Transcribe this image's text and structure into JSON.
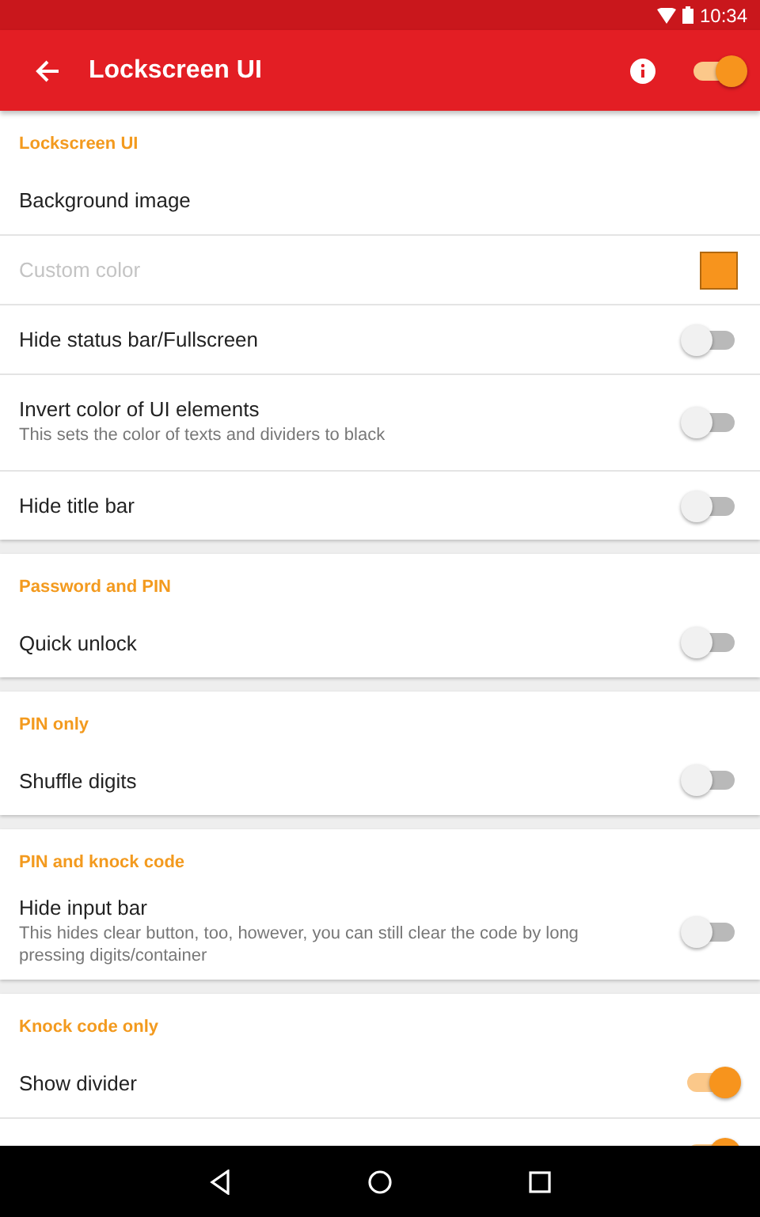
{
  "status_bar": {
    "time": "10:34"
  },
  "app_bar": {
    "title": "Lockscreen UI",
    "master_switch": {
      "on": true
    }
  },
  "sections": [
    {
      "title": "Lockscreen UI",
      "items": [
        {
          "kind": "link",
          "label": "Background image",
          "disabled": false
        },
        {
          "kind": "color",
          "label": "Custom color",
          "disabled": true,
          "color": "#f7941d"
        },
        {
          "kind": "switch",
          "label": "Hide status bar/Fullscreen",
          "disabled": false,
          "on": false
        },
        {
          "kind": "switch",
          "label": "Invert color of UI elements",
          "summary": "This sets the color of texts and dividers to black",
          "disabled": false,
          "on": false
        },
        {
          "kind": "switch",
          "label": "Hide title bar",
          "disabled": false,
          "on": false
        }
      ]
    },
    {
      "title": "Password and PIN",
      "items": [
        {
          "kind": "switch",
          "label": "Quick unlock",
          "disabled": false,
          "on": false
        }
      ]
    },
    {
      "title": "PIN only",
      "items": [
        {
          "kind": "switch",
          "label": "Shuffle digits",
          "disabled": false,
          "on": false
        }
      ]
    },
    {
      "title": "PIN and knock code",
      "items": [
        {
          "kind": "switch",
          "label": "Hide input bar",
          "summary": "This hides clear button, too, however, you can still clear the code by long pressing digits/container",
          "disabled": false,
          "on": false
        }
      ]
    },
    {
      "title": "Knock code only",
      "items": [
        {
          "kind": "switch",
          "label": "Show divider",
          "disabled": false,
          "on": true
        },
        {
          "kind": "switch",
          "on": true
        }
      ]
    }
  ]
}
